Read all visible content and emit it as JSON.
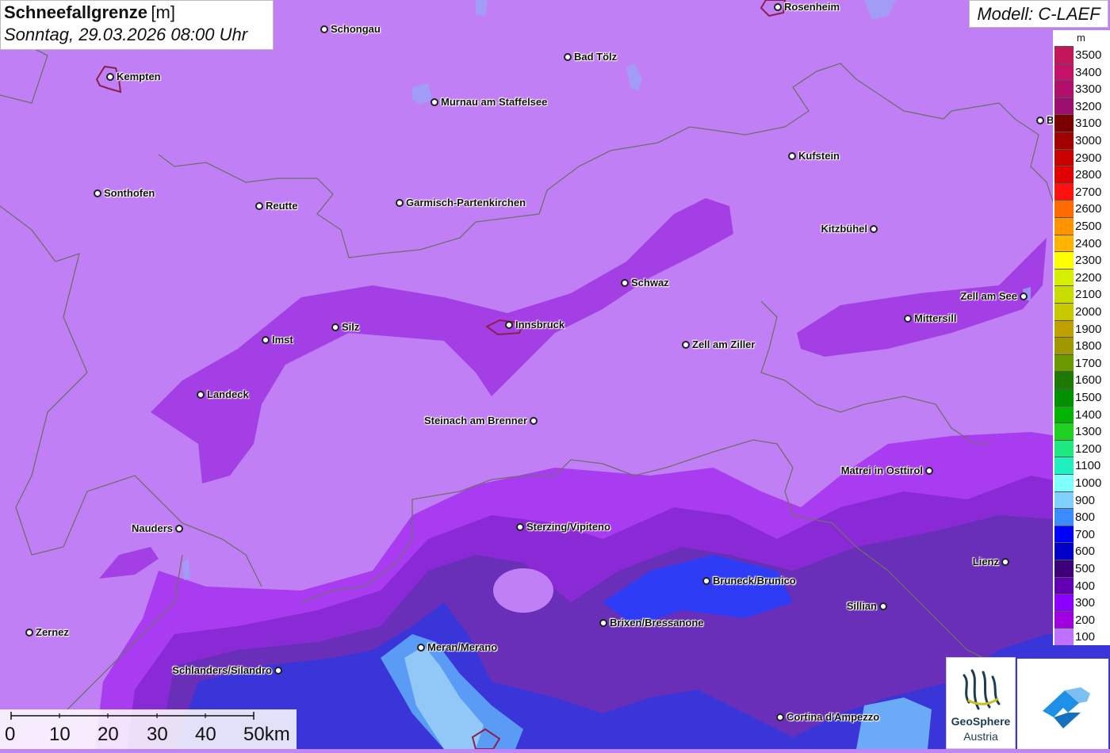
{
  "title": {
    "main": "Schneefallgrenze",
    "unit": "[m]",
    "datetime": "Sonntag, 29.03.2026 08:00 Uhr"
  },
  "model": "Modell: C-LAEF",
  "legend": {
    "unit": "m",
    "entries": [
      {
        "label": "3500",
        "color": "#c2185b"
      },
      {
        "label": "3400",
        "color": "#c4116a"
      },
      {
        "label": "3300",
        "color": "#b0106a"
      },
      {
        "label": "3200",
        "color": "#9c0f6e"
      },
      {
        "label": "3100",
        "color": "#7a0000"
      },
      {
        "label": "3000",
        "color": "#a00000"
      },
      {
        "label": "2900",
        "color": "#c80000"
      },
      {
        "label": "2800",
        "color": "#e00000"
      },
      {
        "label": "2700",
        "color": "#ff1010"
      },
      {
        "label": "2600",
        "color": "#ff6a00"
      },
      {
        "label": "2500",
        "color": "#ff9400"
      },
      {
        "label": "2400",
        "color": "#ffb400"
      },
      {
        "label": "2300",
        "color": "#ffff00"
      },
      {
        "label": "2200",
        "color": "#d4f000"
      },
      {
        "label": "2100",
        "color": "#c8dc00"
      },
      {
        "label": "2000",
        "color": "#c8c800"
      },
      {
        "label": "1900",
        "color": "#c0a000"
      },
      {
        "label": "1800",
        "color": "#a09800"
      },
      {
        "label": "1700",
        "color": "#6a9a00"
      },
      {
        "label": "1600",
        "color": "#1c7a00"
      },
      {
        "label": "1500",
        "color": "#009000"
      },
      {
        "label": "1400",
        "color": "#00b400"
      },
      {
        "label": "1300",
        "color": "#20d020"
      },
      {
        "label": "1200",
        "color": "#20e880"
      },
      {
        "label": "1100",
        "color": "#20f0c0"
      },
      {
        "label": "1000",
        "color": "#80ffff"
      },
      {
        "label": "900",
        "color": "#80d0ff"
      },
      {
        "label": "800",
        "color": "#3c8cff"
      },
      {
        "label": "700",
        "color": "#0000ff"
      },
      {
        "label": "600",
        "color": "#0000c8"
      },
      {
        "label": "500",
        "color": "#3c0078"
      },
      {
        "label": "400",
        "color": "#6400b4"
      },
      {
        "label": "300",
        "color": "#8c00ff"
      },
      {
        "label": "200",
        "color": "#a000e0"
      },
      {
        "label": "100",
        "color": "#c070ff"
      }
    ]
  },
  "cities": [
    {
      "name": "Schongau",
      "side": "r"
    },
    {
      "name": "Rosenheim",
      "side": "r"
    },
    {
      "name": "Kempten",
      "side": "r"
    },
    {
      "name": "Bad Tölz",
      "side": "r"
    },
    {
      "name": "Murnau am Staffelsee",
      "side": "r"
    },
    {
      "name": "Berchtesgaden",
      "side": "r"
    },
    {
      "name": "Kufstein",
      "side": "r"
    },
    {
      "name": "Sonthofen",
      "side": "r"
    },
    {
      "name": "Reutte",
      "side": "r"
    },
    {
      "name": "Garmisch-Partenkirchen",
      "side": "r"
    },
    {
      "name": "Kitzbühel",
      "side": "l"
    },
    {
      "name": "Schwaz",
      "side": "r"
    },
    {
      "name": "Zell am See",
      "side": "l"
    },
    {
      "name": "Innsbruck",
      "side": "r"
    },
    {
      "name": "Mittersill",
      "side": "r"
    },
    {
      "name": "Imst",
      "side": "r"
    },
    {
      "name": "Silz",
      "side": "r"
    },
    {
      "name": "Zell am Ziller",
      "side": "r"
    },
    {
      "name": "Landeck",
      "side": "r"
    },
    {
      "name": "Steinach am Brenner",
      "side": "l"
    },
    {
      "name": "Matrei in Osttirol",
      "side": "l"
    },
    {
      "name": "Nauders",
      "side": "l"
    },
    {
      "name": "Sterzing/Vipiteno",
      "side": "r"
    },
    {
      "name": "Lienz",
      "side": "l"
    },
    {
      "name": "Bruneck/Brunico",
      "side": "r"
    },
    {
      "name": "Sillian",
      "side": "l"
    },
    {
      "name": "Brixen/Bressanone",
      "side": "r"
    },
    {
      "name": "Zernez",
      "side": "r"
    },
    {
      "name": "Meran/Merano",
      "side": "r"
    },
    {
      "name": "Schlanders/Silandro",
      "side": "l"
    },
    {
      "name": "Cortina d'Ampezzo",
      "side": "r"
    }
  ],
  "scale": {
    "labels": [
      "0",
      "10",
      "20",
      "30",
      "40",
      "50km"
    ]
  },
  "logos": {
    "geosphere_name": "GeoSphere",
    "geosphere_sub": "Austria"
  }
}
